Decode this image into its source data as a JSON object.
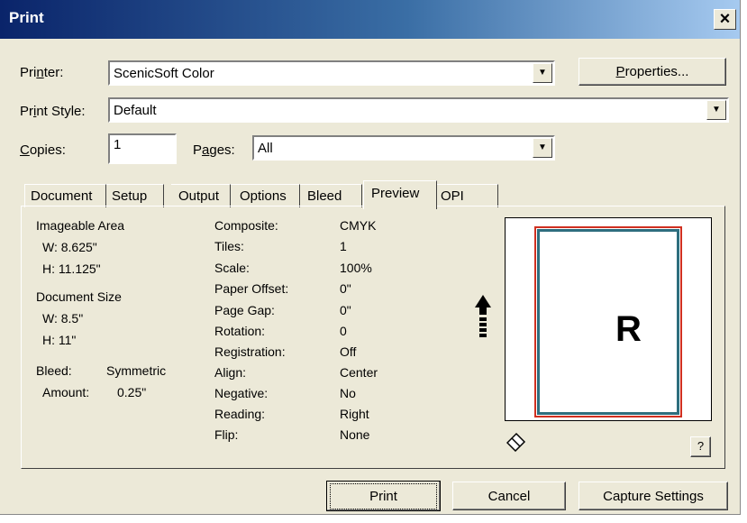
{
  "window": {
    "title": "Print",
    "close_glyph": "×"
  },
  "printer": {
    "label_pre": "Pri",
    "label_ul": "n",
    "label_post": "ter:",
    "value": "ScenicSoft Color",
    "properties_ul": "P",
    "properties_rest": "roperties..."
  },
  "style": {
    "label_pre": "Pr",
    "label_ul": "i",
    "label_post": "nt Style:",
    "value": "Default"
  },
  "copies": {
    "label_ul": "C",
    "label_post": "opies:",
    "value": "1"
  },
  "pages": {
    "label_pre": "P",
    "label_ul": "a",
    "label_post": "ges:",
    "value": "All"
  },
  "tabs": [
    "Document",
    "Setup",
    "Output",
    "Options",
    "Bleed",
    "Preview",
    "OPI"
  ],
  "active_tab": "Preview",
  "info": {
    "imageable_title": "Imageable Area",
    "imageable_w": "W:  8.625\"",
    "imageable_h": "H:  11.125\"",
    "doc_title": "Document Size",
    "doc_w": "W:  8.5\"",
    "doc_h": "H:  11\"",
    "bleed_label": "Bleed:",
    "bleed_value": "Symmetric",
    "amount_label": "Amount:",
    "amount_value": "0.25\""
  },
  "settings": [
    {
      "label": "Composite:",
      "value": "CMYK"
    },
    {
      "label": "Tiles:",
      "value": "1"
    },
    {
      "label": "Scale:",
      "value": "100%"
    },
    {
      "label": "Paper Offset:",
      "value": "0\""
    },
    {
      "label": "Page Gap:",
      "value": "0\""
    },
    {
      "label": "Rotation:",
      "value": "0"
    },
    {
      "label": "Registration:",
      "value": "Off"
    },
    {
      "label": "Align:",
      "value": "Center"
    },
    {
      "label": "Negative:",
      "value": "No"
    },
    {
      "label": "Reading:",
      "value": "Right"
    },
    {
      "label": "Flip:",
      "value": "None"
    }
  ],
  "preview": {
    "letter": "R",
    "help": "?",
    "icons": [
      "up-arrow-icon",
      "eraser-icon"
    ]
  },
  "colors": {
    "page_outer": "#D03020",
    "page_inner": "#2E6E7E"
  },
  "buttons": {
    "print": "Print",
    "cancel": "Cancel",
    "capture": "Capture Settings"
  }
}
